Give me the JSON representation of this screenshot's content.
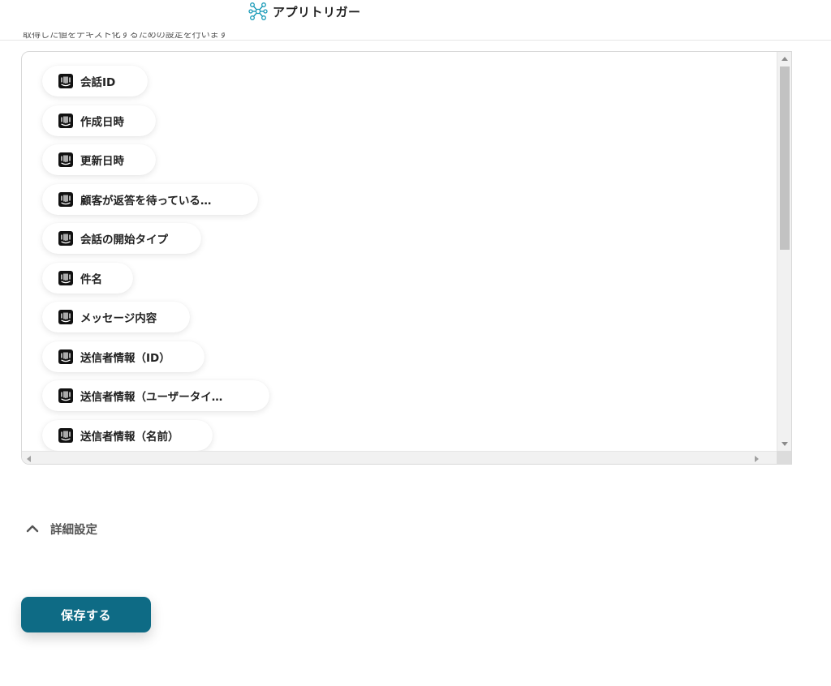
{
  "header": {
    "title": "アプリトリガー",
    "logo_icon": "network-nodes-icon",
    "logo_color": "#1a9bb8"
  },
  "cutoff_text": "取得した値をテキスト化するための設定を行います",
  "outputs": {
    "icon": "intercom-icon",
    "items": [
      {
        "label": "会話ID"
      },
      {
        "label": "作成日時"
      },
      {
        "label": "更新日時"
      },
      {
        "label": "顧客が返答を待っている…"
      },
      {
        "label": "会話の開始タイプ"
      },
      {
        "label": "件名"
      },
      {
        "label": "メッセージ内容"
      },
      {
        "label": "送信者情報（ID）"
      },
      {
        "label": "送信者情報（ユーザータイ…"
      },
      {
        "label": "送信者情報（名前）"
      }
    ]
  },
  "advanced": {
    "label": "詳細設定",
    "icon": "chevron-up-icon"
  },
  "save_button": {
    "label": "保存する",
    "color": "#0e6b85"
  }
}
